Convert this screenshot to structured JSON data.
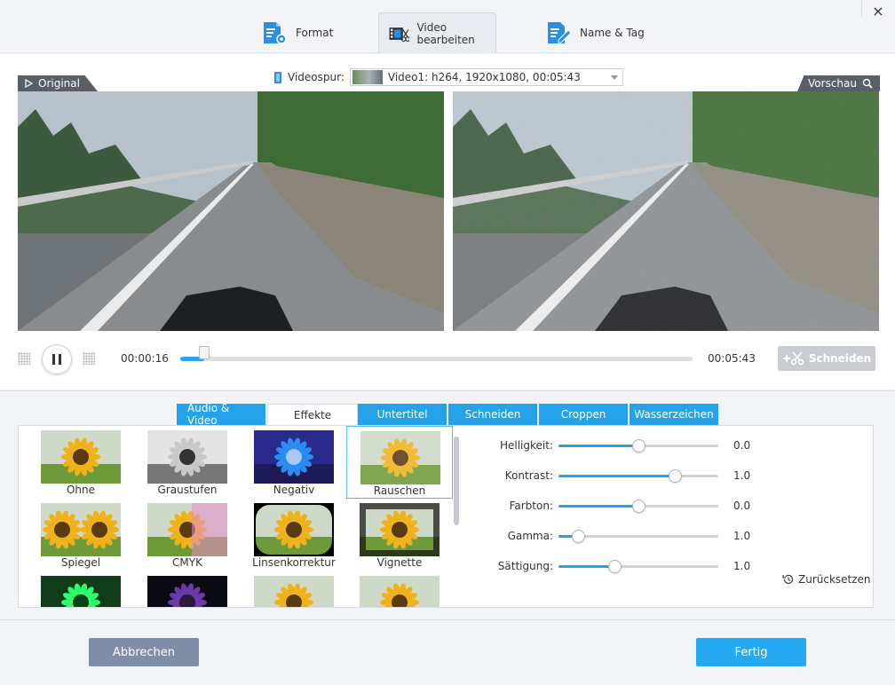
{
  "window": {
    "close_label": "×"
  },
  "tabs_main": [
    {
      "label": "Format",
      "icon": "format-settings-icon"
    },
    {
      "label": "Video bearbeiten",
      "icon": "video-edit-icon",
      "active": true
    },
    {
      "label": "Name & Tag",
      "icon": "name-tag-icon"
    }
  ],
  "videotrack": {
    "label": "Videospur:",
    "value": "Video1: h264, 1920x1080, 00:05:43"
  },
  "labels": {
    "original": "Original",
    "preview": "Vorschau"
  },
  "player": {
    "current_time": "00:00:16",
    "total_time": "00:05:43",
    "progress": 0.046,
    "cut_label": "Schneiden"
  },
  "edit_tabs": [
    {
      "label": "Audio & Video"
    },
    {
      "label": "Effekte",
      "active": true
    },
    {
      "label": "Untertitel"
    },
    {
      "label": "Schneiden"
    },
    {
      "label": "Croppen"
    },
    {
      "label": "Wasserzeichen"
    }
  ],
  "effects": [
    {
      "name": "Ohne",
      "style": "normal"
    },
    {
      "name": "Graustufen",
      "style": "gray"
    },
    {
      "name": "Negativ",
      "style": "negative"
    },
    {
      "name": "Rauschen",
      "style": "noise",
      "selected": true
    },
    {
      "name": "Spiegel",
      "style": "mirror"
    },
    {
      "name": "CMYK",
      "style": "cmyk"
    },
    {
      "name": "Linsenkorrektur",
      "style": "lens"
    },
    {
      "name": "Vignette",
      "style": "vignette"
    },
    {
      "name": "",
      "style": "green"
    },
    {
      "name": "",
      "style": "dark"
    },
    {
      "name": "",
      "style": "normal"
    },
    {
      "name": "",
      "style": "normal"
    }
  ],
  "adjustments": [
    {
      "label": "Helligkeit:",
      "value": "0.0",
      "position": 0.5
    },
    {
      "label": "Kontrast:",
      "value": "1.0",
      "position": 0.73
    },
    {
      "label": "Farbton:",
      "value": "0.0",
      "position": 0.5
    },
    {
      "label": "Gamma:",
      "value": "1.0",
      "position": 0.12
    },
    {
      "label": "Sättigung:",
      "value": "1.0",
      "position": 0.35
    }
  ],
  "reset_label": "Zurücksetzen",
  "buttons": {
    "cancel": "Abbrechen",
    "ok": "Fertig"
  },
  "colors": {
    "accent": "#25a3ea",
    "cancel": "#7e8ea7",
    "label_bg": "#595f66"
  }
}
